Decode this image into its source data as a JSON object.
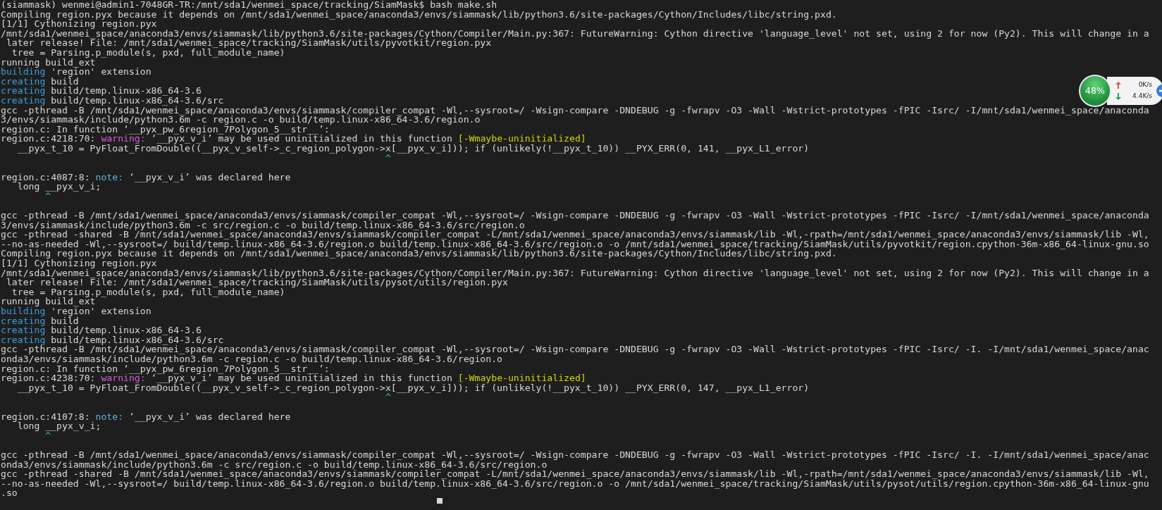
{
  "terminal": {
    "lines": [
      {
        "parts": [
          {
            "kind": "plain",
            "text": "(siammask) wenmei@admin1-7048GR-TR:/mnt/sda1/wenmei_space/tracking/SiamMask$ bash make.sh"
          }
        ]
      },
      {
        "parts": [
          {
            "kind": "plain",
            "text": "Compiling region.pyx because it depends on /mnt/sda1/wenmei_space/anaconda3/envs/siammask/lib/python3.6/site-packages/Cython/Includes/libc/string.pxd."
          }
        ]
      },
      {
        "parts": [
          {
            "kind": "plain",
            "text": "[1/1] Cythonizing region.pyx"
          }
        ]
      },
      {
        "parts": [
          {
            "kind": "plain",
            "text": "/mnt/sda1/wenmei_space/anaconda3/envs/siammask/lib/python3.6/site-packages/Cython/Compiler/Main.py:367: FutureWarning: Cython directive 'language_level' not set, using 2 for now (Py2). This will change in a"
          }
        ]
      },
      {
        "parts": [
          {
            "kind": "plain",
            "text": " later release! File: /mnt/sda1/wenmei_space/tracking/SiamMask/utils/pyvotkit/region.pyx"
          }
        ]
      },
      {
        "parts": [
          {
            "kind": "plain",
            "text": "  tree = Parsing.p_module(s, pxd, full_module_name)"
          }
        ]
      },
      {
        "parts": [
          {
            "kind": "plain",
            "text": "running build_ext"
          }
        ]
      },
      {
        "parts": [
          {
            "kind": "action",
            "text": "building"
          },
          {
            "kind": "plain",
            "text": " 'region' extension"
          }
        ]
      },
      {
        "parts": [
          {
            "kind": "action",
            "text": "creating"
          },
          {
            "kind": "plain",
            "text": " build"
          }
        ]
      },
      {
        "parts": [
          {
            "kind": "action",
            "text": "creating"
          },
          {
            "kind": "plain",
            "text": " build/temp.linux-x86_64-3.6"
          }
        ]
      },
      {
        "parts": [
          {
            "kind": "action",
            "text": "creating"
          },
          {
            "kind": "plain",
            "text": " build/temp.linux-x86_64-3.6/src"
          }
        ]
      },
      {
        "parts": [
          {
            "kind": "plain",
            "text": "gcc -pthread -B /mnt/sda1/wenmei_space/anaconda3/envs/siammask/compiler_compat -Wl,--sysroot=/ -Wsign-compare -DNDEBUG -g -fwrapv -O3 -Wall -Wstrict-prototypes -fPIC -Isrc/ -I/mnt/sda1/wenmei_space/anaconda"
          }
        ]
      },
      {
        "parts": [
          {
            "kind": "plain",
            "text": "3/envs/siammask/include/python3.6m -c region.c -o build/temp.linux-x86_64-3.6/region.o"
          }
        ]
      },
      {
        "parts": [
          {
            "kind": "plain",
            "text": "region.c: In function ‘__pyx_pw_6region_7Polygon_5__str__’:"
          }
        ]
      },
      {
        "parts": [
          {
            "kind": "plain",
            "text": "region.c:4218:70: "
          },
          {
            "kind": "warning",
            "text": "warning:"
          },
          {
            "kind": "plain",
            "text": " ‘__pyx_v_i’ may be used uninitialized in this function "
          },
          {
            "kind": "flag",
            "text": "[-Wmaybe-uninitialized]"
          }
        ]
      },
      {
        "parts": [
          {
            "kind": "plain",
            "text": "   __pyx_t_10 = PyFloat_FromDouble((__pyx_v_self->_c_region_polygon->x[__pyx_v_i])); if (unlikely(!__pyx_t_10)) __PYX_ERR(0, 141, __pyx_L1_error)"
          }
        ]
      },
      {
        "parts": [
          {
            "kind": "caret",
            "text": "                                                                     ^"
          }
        ]
      },
      {
        "kind": "blank"
      },
      {
        "parts": [
          {
            "kind": "plain",
            "text": "region.c:4087:8: "
          },
          {
            "kind": "note",
            "text": "note:"
          },
          {
            "kind": "plain",
            "text": " ‘__pyx_v_i’ was declared here"
          }
        ]
      },
      {
        "parts": [
          {
            "kind": "plain",
            "text": "   long __pyx_v_i;"
          }
        ]
      },
      {
        "parts": [
          {
            "kind": "caret",
            "text": "        ^"
          }
        ]
      },
      {
        "kind": "blank"
      },
      {
        "parts": [
          {
            "kind": "plain",
            "text": "gcc -pthread -B /mnt/sda1/wenmei_space/anaconda3/envs/siammask/compiler_compat -Wl,--sysroot=/ -Wsign-compare -DNDEBUG -g -fwrapv -O3 -Wall -Wstrict-prototypes -fPIC -Isrc/ -I/mnt/sda1/wenmei_space/anaconda"
          }
        ]
      },
      {
        "parts": [
          {
            "kind": "plain",
            "text": "3/envs/siammask/include/python3.6m -c src/region.c -o build/temp.linux-x86_64-3.6/src/region.o"
          }
        ]
      },
      {
        "parts": [
          {
            "kind": "plain",
            "text": "gcc -pthread -shared -B /mnt/sda1/wenmei_space/anaconda3/envs/siammask/compiler_compat -L/mnt/sda1/wenmei_space/anaconda3/envs/siammask/lib -Wl,-rpath=/mnt/sda1/wenmei_space/anaconda3/envs/siammask/lib -Wl,"
          }
        ]
      },
      {
        "parts": [
          {
            "kind": "plain",
            "text": "--no-as-needed -Wl,--sysroot=/ build/temp.linux-x86_64-3.6/region.o build/temp.linux-x86_64-3.6/src/region.o -o /mnt/sda1/wenmei_space/tracking/SiamMask/utils/pyvotkit/region.cpython-36m-x86_64-linux-gnu.so"
          }
        ]
      },
      {
        "parts": [
          {
            "kind": "plain",
            "text": "Compiling region.pyx because it depends on /mnt/sda1/wenmei_space/anaconda3/envs/siammask/lib/python3.6/site-packages/Cython/Includes/libc/string.pxd."
          }
        ]
      },
      {
        "parts": [
          {
            "kind": "plain",
            "text": "[1/1] Cythonizing region.pyx"
          }
        ]
      },
      {
        "parts": [
          {
            "kind": "plain",
            "text": "/mnt/sda1/wenmei_space/anaconda3/envs/siammask/lib/python3.6/site-packages/Cython/Compiler/Main.py:367: FutureWarning: Cython directive 'language_level' not set, using 2 for now (Py2). This will change in a"
          }
        ]
      },
      {
        "parts": [
          {
            "kind": "plain",
            "text": " later release! File: /mnt/sda1/wenmei_space/tracking/SiamMask/utils/pysot/utils/region.pyx"
          }
        ]
      },
      {
        "parts": [
          {
            "kind": "plain",
            "text": "  tree = Parsing.p_module(s, pxd, full_module_name)"
          }
        ]
      },
      {
        "parts": [
          {
            "kind": "plain",
            "text": "running build_ext"
          }
        ]
      },
      {
        "parts": [
          {
            "kind": "action",
            "text": "building"
          },
          {
            "kind": "plain",
            "text": " 'region' extension"
          }
        ]
      },
      {
        "parts": [
          {
            "kind": "action",
            "text": "creating"
          },
          {
            "kind": "plain",
            "text": " build"
          }
        ]
      },
      {
        "parts": [
          {
            "kind": "action",
            "text": "creating"
          },
          {
            "kind": "plain",
            "text": " build/temp.linux-x86_64-3.6"
          }
        ]
      },
      {
        "parts": [
          {
            "kind": "action",
            "text": "creating"
          },
          {
            "kind": "plain",
            "text": " build/temp.linux-x86_64-3.6/src"
          }
        ]
      },
      {
        "parts": [
          {
            "kind": "plain",
            "text": "gcc -pthread -B /mnt/sda1/wenmei_space/anaconda3/envs/siammask/compiler_compat -Wl,--sysroot=/ -Wsign-compare -DNDEBUG -g -fwrapv -O3 -Wall -Wstrict-prototypes -fPIC -Isrc/ -I. -I/mnt/sda1/wenmei_space/anac"
          }
        ]
      },
      {
        "parts": [
          {
            "kind": "plain",
            "text": "onda3/envs/siammask/include/python3.6m -c region.c -o build/temp.linux-x86_64-3.6/region.o"
          }
        ]
      },
      {
        "parts": [
          {
            "kind": "plain",
            "text": "region.c: In function ‘__pyx_pw_6region_7Polygon_5__str__’:"
          }
        ]
      },
      {
        "parts": [
          {
            "kind": "plain",
            "text": "region.c:4238:70: "
          },
          {
            "kind": "warning",
            "text": "warning:"
          },
          {
            "kind": "plain",
            "text": " ‘__pyx_v_i’ may be used uninitialized in this function "
          },
          {
            "kind": "flag",
            "text": "[-Wmaybe-uninitialized]"
          }
        ]
      },
      {
        "parts": [
          {
            "kind": "plain",
            "text": "   __pyx_t_10 = PyFloat_FromDouble((__pyx_v_self->_c_region_polygon->x[__pyx_v_i])); if (unlikely(!__pyx_t_10)) __PYX_ERR(0, 147, __pyx_L1_error)"
          }
        ]
      },
      {
        "parts": [
          {
            "kind": "caret",
            "text": "                                                                     ^"
          }
        ]
      },
      {
        "kind": "blank"
      },
      {
        "parts": [
          {
            "kind": "plain",
            "text": "region.c:4107:8: "
          },
          {
            "kind": "note",
            "text": "note:"
          },
          {
            "kind": "plain",
            "text": " ‘__pyx_v_i’ was declared here"
          }
        ]
      },
      {
        "parts": [
          {
            "kind": "plain",
            "text": "   long __pyx_v_i;"
          }
        ]
      },
      {
        "parts": [
          {
            "kind": "caret",
            "text": "        ^"
          }
        ]
      },
      {
        "kind": "blank"
      },
      {
        "parts": [
          {
            "kind": "plain",
            "text": "gcc -pthread -B /mnt/sda1/wenmei_space/anaconda3/envs/siammask/compiler_compat -Wl,--sysroot=/ -Wsign-compare -DNDEBUG -g -fwrapv -O3 -Wall -Wstrict-prototypes -fPIC -Isrc/ -I. -I/mnt/sda1/wenmei_space/anac"
          }
        ]
      },
      {
        "parts": [
          {
            "kind": "plain",
            "text": "onda3/envs/siammask/include/python3.6m -c src/region.c -o build/temp.linux-x86_64-3.6/src/region.o"
          }
        ]
      },
      {
        "parts": [
          {
            "kind": "plain",
            "text": "gcc -pthread -shared -B /mnt/sda1/wenmei_space/anaconda3/envs/siammask/compiler_compat -L/mnt/sda1/wenmei_space/anaconda3/envs/siammask/lib -Wl,-rpath=/mnt/sda1/wenmei_space/anaconda3/envs/siammask/lib -Wl,"
          }
        ]
      },
      {
        "parts": [
          {
            "kind": "plain",
            "text": "--no-as-needed -Wl,--sysroot=/ build/temp.linux-x86_64-3.6/region.o build/temp.linux-x86_64-3.6/src/region.o -o /mnt/sda1/wenmei_space/tracking/SiamMask/utils/pysot/utils/region.cpython-36m-x86_64-linux-gnu"
          }
        ]
      },
      {
        "parts": [
          {
            "kind": "plain",
            "text": ".so"
          }
        ]
      }
    ]
  },
  "net_monitor": {
    "percent": "48%",
    "upload": "0K/s",
    "download": "4.4K/s"
  }
}
